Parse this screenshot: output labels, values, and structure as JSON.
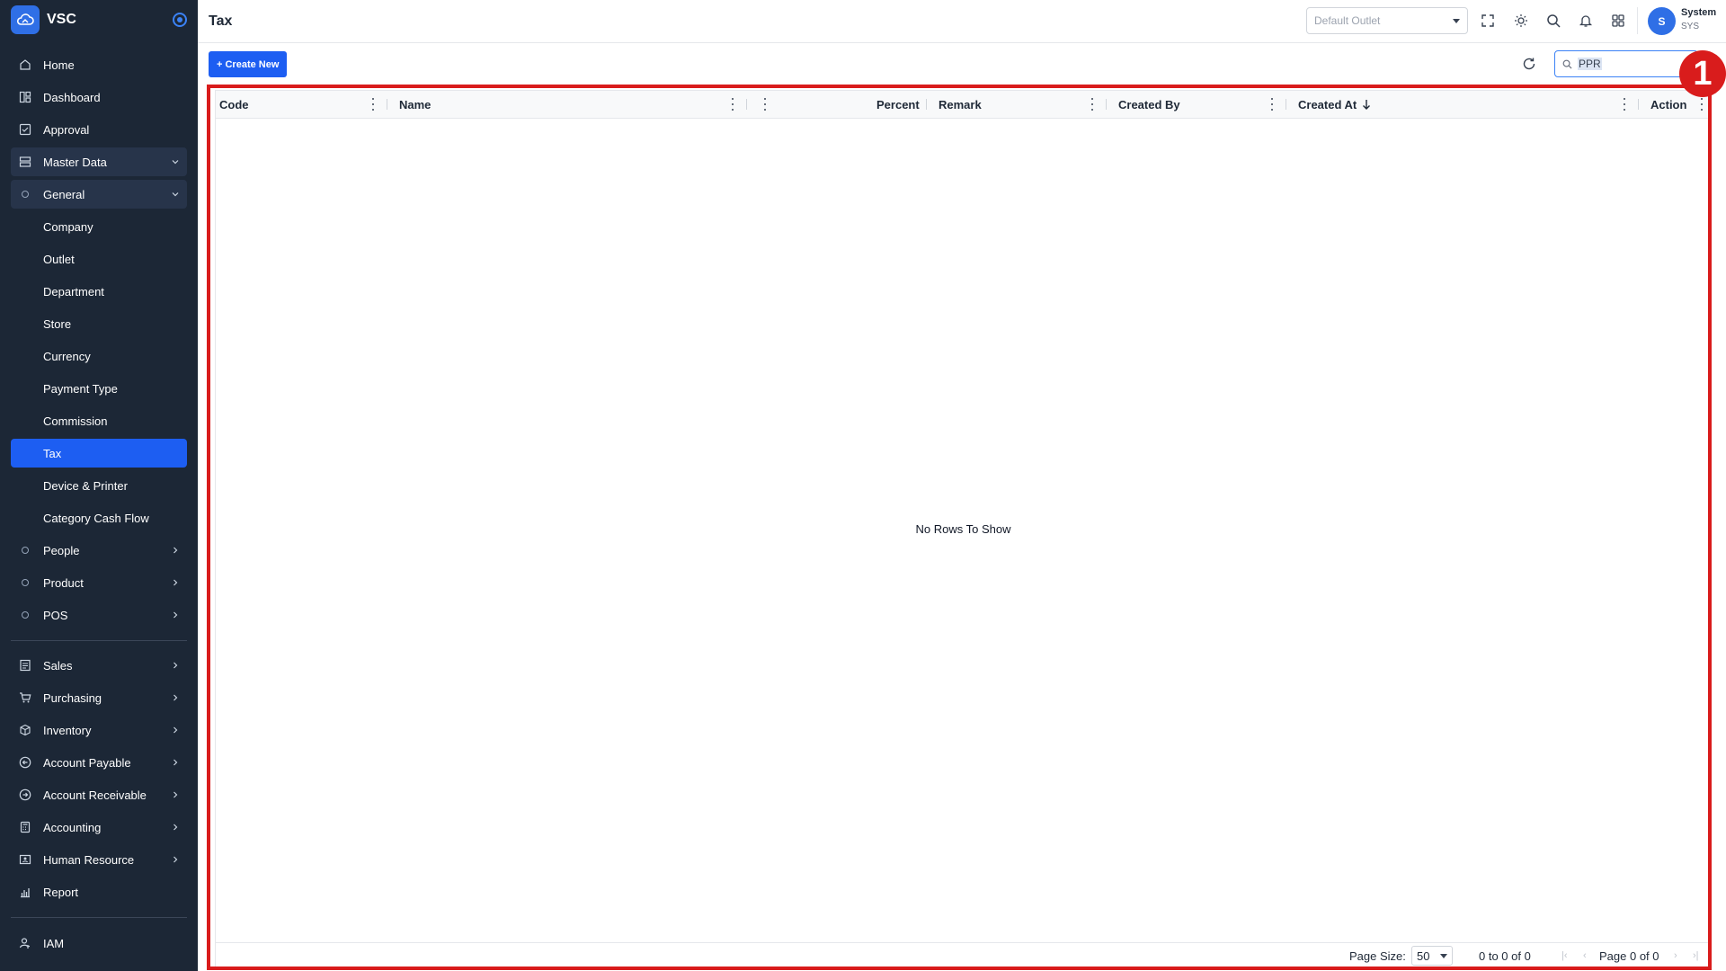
{
  "app": {
    "brand": "VSC"
  },
  "sidebar": {
    "items": [
      {
        "label": "Home",
        "icon": "home-icon"
      },
      {
        "label": "Dashboard",
        "icon": "dashboard-icon"
      },
      {
        "label": "Approval",
        "icon": "approval-icon"
      },
      {
        "label": "Master Data",
        "icon": "master-data-icon"
      },
      {
        "label": "General",
        "icon": "bullet-icon"
      },
      {
        "label": "Company"
      },
      {
        "label": "Outlet"
      },
      {
        "label": "Department"
      },
      {
        "label": "Store"
      },
      {
        "label": "Currency"
      },
      {
        "label": "Payment Type"
      },
      {
        "label": "Commission"
      },
      {
        "label": "Tax"
      },
      {
        "label": "Device & Printer"
      },
      {
        "label": "Category Cash Flow"
      },
      {
        "label": "People",
        "icon": "bullet-icon"
      },
      {
        "label": "Product",
        "icon": "bullet-icon"
      },
      {
        "label": "POS",
        "icon": "bullet-icon"
      },
      {
        "label": "Sales",
        "icon": "sales-icon"
      },
      {
        "label": "Purchasing",
        "icon": "cart-icon"
      },
      {
        "label": "Inventory",
        "icon": "box-icon"
      },
      {
        "label": "Account Payable",
        "icon": "arrow-left-circle-icon"
      },
      {
        "label": "Account Receivable",
        "icon": "arrow-right-circle-icon"
      },
      {
        "label": "Accounting",
        "icon": "calculator-icon"
      },
      {
        "label": "Human Resource",
        "icon": "id-card-icon"
      },
      {
        "label": "Report",
        "icon": "report-icon"
      },
      {
        "label": "IAM",
        "icon": "user-key-icon"
      }
    ]
  },
  "header": {
    "title": "Tax",
    "outlet_placeholder": "Default Outlet",
    "user_name": "System",
    "user_code": "SYS",
    "avatar_initial": "S"
  },
  "toolbar": {
    "create_label": "+ Create New",
    "search_value": "PPR"
  },
  "grid": {
    "columns": [
      "Code",
      "Name",
      "Percent",
      "Remark",
      "Created By",
      "Created At",
      "Action"
    ],
    "empty_message": "No Rows To Show",
    "page_size_label": "Page Size:",
    "page_size": "50",
    "row_summary": "0 to 0 of 0",
    "page_summary": "Page 0 of 0"
  },
  "annotation": {
    "marker": "1"
  },
  "colors": {
    "accent": "#1d5ef2",
    "sidebar_bg": "#1c2736",
    "highlight": "#d91c1c"
  }
}
